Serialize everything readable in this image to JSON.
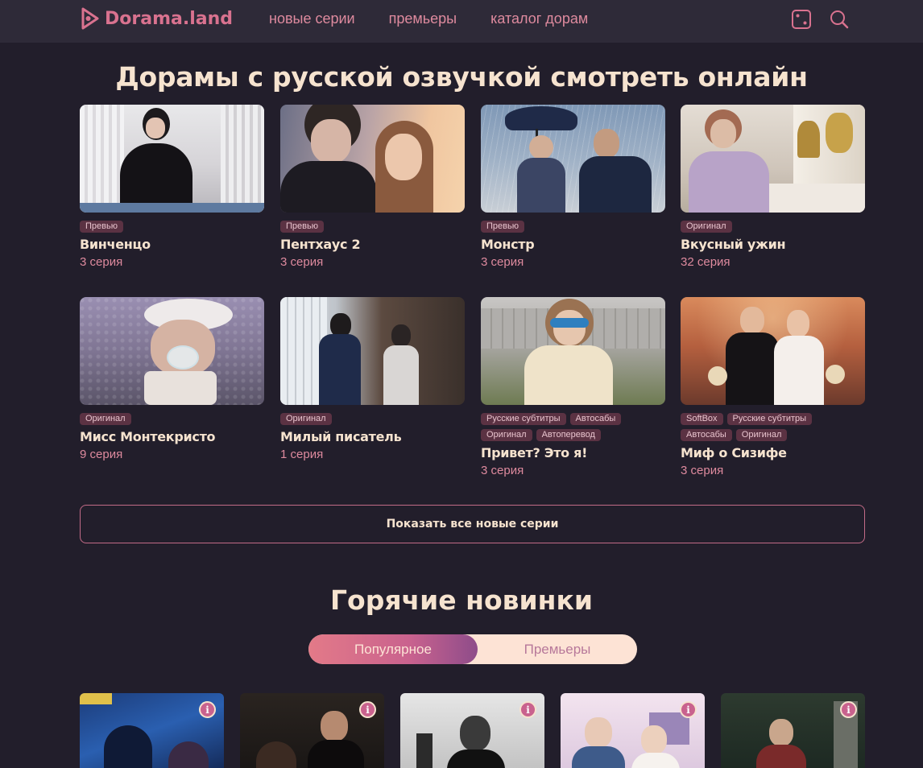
{
  "header": {
    "logo_text": "Dorama.land",
    "nav": [
      "новые серии",
      "премьеры",
      "каталог дорам"
    ]
  },
  "new_episodes": {
    "title": "Дорамы с русской озвучкой смотреть онлайн",
    "cards": [
      {
        "title": "Винченцо",
        "episode": "3 серия",
        "badges": [
          "Превью"
        ]
      },
      {
        "title": "Пентхаус 2",
        "episode": "3 серия",
        "badges": [
          "Превью"
        ]
      },
      {
        "title": "Монстр",
        "episode": "3 серия",
        "badges": [
          "Превью"
        ]
      },
      {
        "title": "Вкусный ужин",
        "episode": "32 серия",
        "badges": [
          "Оригинал"
        ]
      },
      {
        "title": "Мисс Монтекристо",
        "episode": "9 серия",
        "badges": [
          "Оригинал"
        ]
      },
      {
        "title": "Милый писатель",
        "episode": "1 серия",
        "badges": [
          "Оригинал"
        ]
      },
      {
        "title": "Привет? Это я!",
        "episode": "3 серия",
        "badges": [
          "Русские субтитры",
          "Автосабы",
          "Оригинал",
          "Автоперевод"
        ]
      },
      {
        "title": "Миф о Сизифе",
        "episode": "3 серия",
        "badges": [
          "SoftBox",
          "Русские субтитры",
          "Автосабы",
          "Оригинал"
        ]
      }
    ],
    "show_all_label": "Показать все новые серии"
  },
  "hot": {
    "title": "Горячие новинки",
    "tabs": [
      "Популярное",
      "Премьеры"
    ],
    "info_glyph": "i"
  },
  "colors": {
    "background": "#221e2b",
    "header": "#2e2a38",
    "accent": "#de8a9e",
    "cream": "#f6e3cf",
    "badge": "#5b3243"
  }
}
